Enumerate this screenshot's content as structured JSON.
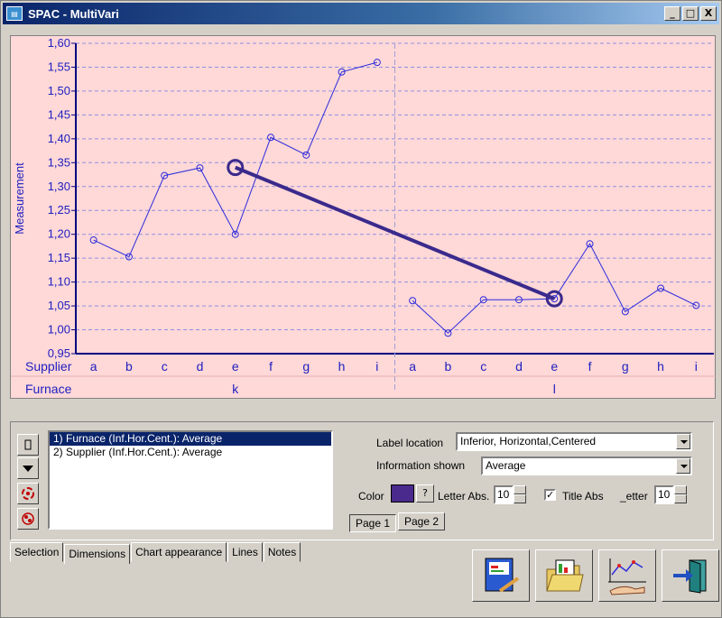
{
  "window": {
    "title": "SPAC - MultiVari",
    "minimize": "_",
    "maximize": "□",
    "close": "X"
  },
  "chart_data": {
    "type": "line",
    "ylabel": "Measurement",
    "ylim": [
      0.95,
      1.6
    ],
    "yticks": [
      "0,95",
      "1,00",
      "1,05",
      "1,10",
      "1,15",
      "1,20",
      "1,25",
      "1,30",
      "1,35",
      "1,40",
      "1,45",
      "1,50",
      "1,55",
      "1,60"
    ],
    "grid": true,
    "supplier_label": "Supplier",
    "furnace_label": "Furnace",
    "categories": [
      "a",
      "b",
      "c",
      "d",
      "e",
      "f",
      "g",
      "h",
      "i"
    ],
    "groups": [
      {
        "name": "k",
        "values": [
          1.188,
          1.153,
          1.323,
          1.339,
          1.2,
          1.403,
          1.366,
          1.54,
          1.56
        ]
      },
      {
        "name": "l",
        "values": [
          1.061,
          0.993,
          1.063,
          1.063,
          1.065,
          1.18,
          1.038,
          1.087,
          1.051
        ]
      }
    ],
    "connector": {
      "from_group": "k",
      "from_category": "e",
      "from_value": 1.34,
      "to_group": "l",
      "to_category": "e",
      "to_value": 1.065
    }
  },
  "colors": {
    "plot_bg": "#ffd8d8",
    "series": "#2b2bdc",
    "connector": "#3a2a8c",
    "axis_text": "#2020c0"
  },
  "list": {
    "items": [
      {
        "label": "1) Furnace (Inf.Hor.Cent.): Average",
        "selected": true
      },
      {
        "label": "2) Supplier (Inf.Hor.Cent.): Average",
        "selected": false
      }
    ]
  },
  "settings": {
    "label_location_label": "Label location",
    "label_location_value": "Inferior, Horizontal,Centered",
    "information_shown_label": "Information shown",
    "information_shown_value": "Average",
    "color_label": "Color",
    "color_value": "#4a2a8c",
    "question_label": "?",
    "letter_abs_label": "Letter Abs.",
    "letter_abs_value": "10",
    "title_abs_label": "Title Abs",
    "title_abs_checked": true,
    "letter_label": "_etter",
    "letter_value": "10",
    "page1": "Page 1",
    "page2": "Page 2"
  },
  "tabs": [
    "Selection",
    "Dimensions",
    "Chart appearance",
    "Lines",
    "Notes"
  ],
  "active_tab": "Dimensions",
  "actions": [
    {
      "icon": "report-edit-icon"
    },
    {
      "icon": "open-folder-icon"
    },
    {
      "icon": "chart-hand-icon"
    },
    {
      "icon": "exit-door-icon"
    }
  ]
}
